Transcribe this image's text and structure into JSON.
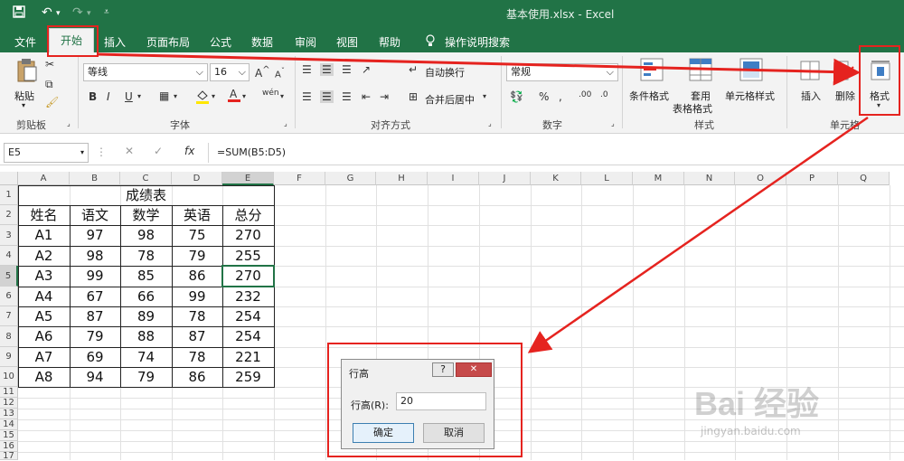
{
  "titlebar": {
    "title": "基本使用.xlsx  -  Excel"
  },
  "menu": {
    "items": [
      "文件",
      "开始",
      "插入",
      "页面布局",
      "公式",
      "数据",
      "审阅",
      "视图",
      "帮助"
    ],
    "search": "操作说明搜索"
  },
  "ribbon": {
    "paste": "粘贴",
    "clipboard_group": "剪贴板",
    "font_name": "等线",
    "font_size": "16",
    "font_group": "字体",
    "bold": "B",
    "italic": "I",
    "underline": "U",
    "wrap_text": "自动换行",
    "merge_center": "合并后居中",
    "align_group": "对齐方式",
    "number_format": "常规",
    "number_group": "数字",
    "conditional_format": "条件格式",
    "table_format_1": "套用",
    "table_format_2": "表格格式",
    "cell_style": "单元格样式",
    "style_group": "样式",
    "insert": "插入",
    "delete": "删除",
    "format": "格式",
    "cells_group": "单元格"
  },
  "formula_bar": {
    "name_box": "E5",
    "fx": "fx",
    "formula": "=SUM(B5:D5)"
  },
  "sheet": {
    "columns": [
      "A",
      "B",
      "C",
      "D",
      "E",
      "F",
      "G",
      "H",
      "I",
      "J",
      "K",
      "L",
      "M",
      "N",
      "O",
      "P",
      "Q"
    ],
    "rows": [
      "1",
      "2",
      "3",
      "4",
      "5",
      "6",
      "7",
      "8",
      "9",
      "10",
      "11",
      "12",
      "13",
      "14",
      "15",
      "16",
      "17"
    ],
    "title": "成绩表",
    "headers": [
      "姓名",
      "语文",
      "数学",
      "英语",
      "总分"
    ],
    "data": [
      [
        "A1",
        "97",
        "98",
        "75",
        "270"
      ],
      [
        "A2",
        "98",
        "78",
        "79",
        "255"
      ],
      [
        "A3",
        "99",
        "85",
        "86",
        "270"
      ],
      [
        "A4",
        "67",
        "66",
        "99",
        "232"
      ],
      [
        "A5",
        "87",
        "89",
        "78",
        "254"
      ],
      [
        "A6",
        "79",
        "88",
        "87",
        "254"
      ],
      [
        "A7",
        "69",
        "74",
        "78",
        "221"
      ],
      [
        "A8",
        "94",
        "79",
        "86",
        "259"
      ]
    ]
  },
  "dialog": {
    "title": "行高",
    "help": "?",
    "label": "行高(R):",
    "value": "20",
    "ok": "确定",
    "cancel": "取消"
  },
  "watermark": {
    "text": "Bai 经验",
    "url": "jingyan.baidu.com"
  },
  "colors": {
    "excel_green": "#217346",
    "annotation_red": "#e5231f",
    "selection": "#217346"
  }
}
